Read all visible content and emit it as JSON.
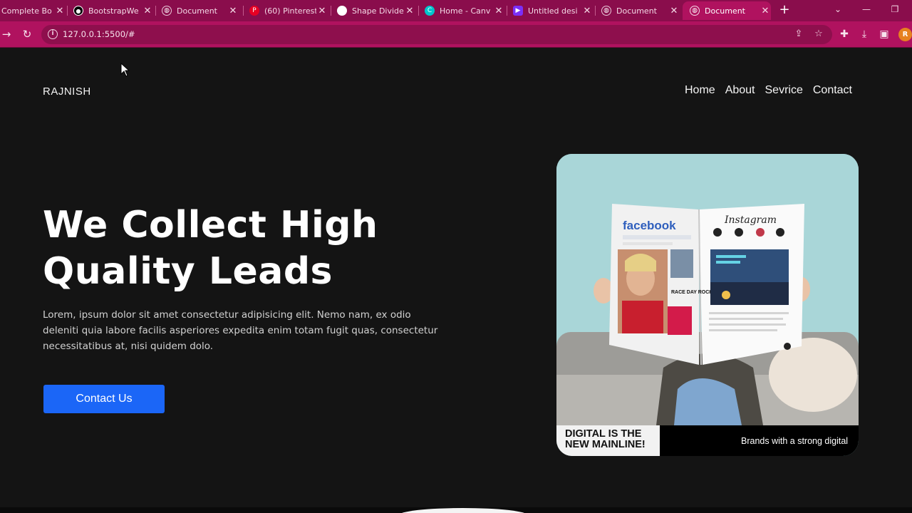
{
  "browser": {
    "tabs": [
      {
        "title": "Complete Bo",
        "icon": "globe-icon",
        "color": "#8a0d4c"
      },
      {
        "title": "BootstrapWe",
        "icon": "github-icon",
        "color": "#000000"
      },
      {
        "title": "Document",
        "icon": "globe-icon",
        "color": "#6b6b6b"
      },
      {
        "title": "(60) Pinterest",
        "icon": "pinterest-icon",
        "color": "#e60023"
      },
      {
        "title": "Shape Divide",
        "icon": "shape-icon",
        "color": "#ffffff"
      },
      {
        "title": "Home - Canv",
        "icon": "canva-icon",
        "color": "#00c4cc"
      },
      {
        "title": "Untitled desi",
        "icon": "video-icon",
        "color": "#7b2ff7"
      },
      {
        "title": "Document",
        "icon": "globe-icon",
        "color": "#6b6b6b"
      },
      {
        "title": "Document",
        "icon": "globe-icon",
        "color": "#6b6b6b",
        "active": true
      }
    ],
    "url": "127.0.0.1:5500/#",
    "accent": "#b0125f",
    "profile_initial": "R"
  },
  "site": {
    "brand": "RAJNISH",
    "nav": [
      "Home",
      "About",
      "Sevrice",
      "Contact"
    ],
    "hero": {
      "title_line1": "We Collect High",
      "title_line2": "Quality Leads",
      "text": "Lorem, ipsum dolor sit amet consectetur adipisicing elit. Nemo nam, ex odio deleniti quia labore facilis asperiores expedita enim totam fugit quas, consectetur necessitatibus at, nisi quidem dolo.",
      "cta": "Contact Us",
      "cta_color": "#1b66f7"
    },
    "image": {
      "headline_line1": "DIGITAL IS THE",
      "headline_line2": "NEW MAINLINE!",
      "tagline": "Brands with a strong digital",
      "newspaper": {
        "left_brand": "facebook",
        "right_brand": "Instagram",
        "headline": "RACE DAY ROCKET"
      }
    }
  }
}
